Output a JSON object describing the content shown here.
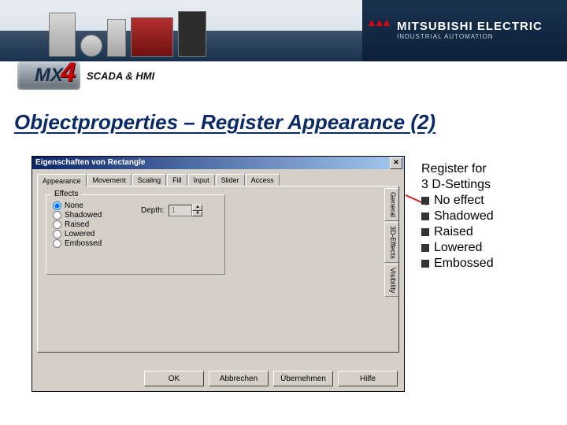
{
  "brand": {
    "line1": "MITSUBISHI ELECTRIC",
    "line2": "INDUSTRIAL AUTOMATION"
  },
  "mx4": {
    "mx": "MX",
    "four": "4"
  },
  "scada_label": "SCADA & HMI",
  "slide_title": "Objectproperties – Register Appearance (2)",
  "dialog": {
    "title": "Eigenschaften von Rectangle",
    "tabs": [
      "Appearance",
      "Movement",
      "Scaling",
      "Fill",
      "Input",
      "Slider",
      "Access"
    ],
    "effects_group_title": "Effects",
    "effects_options": [
      "None",
      "Shadowed",
      "Raised",
      "Lowered",
      "Embossed"
    ],
    "effects_selected": "None",
    "depth_label": "Depth:",
    "depth_value": "1",
    "vertical_tabs": [
      "General",
      "3D-Effects",
      "Visibility"
    ],
    "vertical_tab_active": "3D-Effects",
    "buttons": [
      "OK",
      "Abbrechen",
      "Übernehmen",
      "Hilfe"
    ]
  },
  "desc": {
    "heading_l1": "Register for",
    "heading_l2": "3 D-Settings",
    "bullets": [
      "No effect",
      "Shadowed",
      "Raised",
      "Lowered",
      "Embossed"
    ]
  }
}
